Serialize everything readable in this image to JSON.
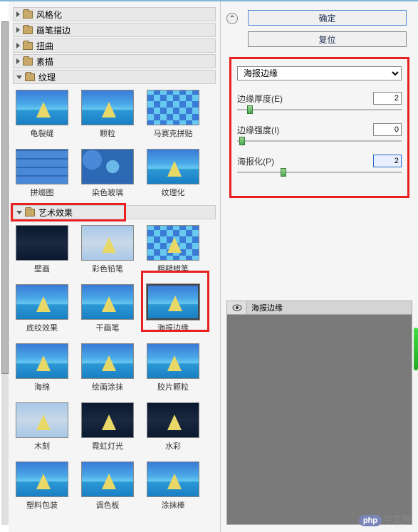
{
  "categories_closed": [
    {
      "label": "风格化"
    },
    {
      "label": "画笔描边"
    },
    {
      "label": "扭曲"
    },
    {
      "label": "素描"
    }
  ],
  "texture_cat": {
    "label": "纹理"
  },
  "texture_items": [
    {
      "label": "龟裂缝",
      "style": ""
    },
    {
      "label": "颗粒",
      "style": ""
    },
    {
      "label": "马赛克拼贴",
      "style": "mosaic noafter"
    },
    {
      "label": "拼缀图",
      "style": "tiles noafter"
    },
    {
      "label": "染色玻璃",
      "style": "stained noafter"
    },
    {
      "label": "纹理化",
      "style": ""
    }
  ],
  "art_cat": {
    "label": "艺术效果"
  },
  "art_items": [
    {
      "label": "壁画",
      "style": "dark noafter"
    },
    {
      "label": "彩色铅笔",
      "style": "sketch"
    },
    {
      "label": "粗糙蜡笔",
      "style": "mosaic"
    },
    {
      "label": "底纹效果",
      "style": ""
    },
    {
      "label": "干画笔",
      "style": ""
    },
    {
      "label": "海报边缘",
      "style": "",
      "selected": true
    },
    {
      "label": "海绵",
      "style": ""
    },
    {
      "label": "绘画涂抹",
      "style": ""
    },
    {
      "label": "胶片颗粒",
      "style": ""
    },
    {
      "label": "木刻",
      "style": "sketch"
    },
    {
      "label": "霓虹灯光",
      "style": "dark"
    },
    {
      "label": "水彩",
      "style": "dark"
    },
    {
      "label": "塑料包装",
      "style": ""
    },
    {
      "label": "调色板",
      "style": ""
    },
    {
      "label": "涂抹棒",
      "style": ""
    }
  ],
  "buttons": {
    "ok": "确定",
    "reset": "复位"
  },
  "filter_select": "海报边缘",
  "params": [
    {
      "label": "边缘厚度(E)",
      "value": "2",
      "pos": 8
    },
    {
      "label": "边缘强度(I)",
      "value": "0",
      "pos": 3
    },
    {
      "label": "海报化(P)",
      "value": "2",
      "pos": 28,
      "active": true
    }
  ],
  "preview": {
    "label": "海报边缘"
  },
  "watermark": {
    "badge": "php",
    "text": "中文网"
  }
}
